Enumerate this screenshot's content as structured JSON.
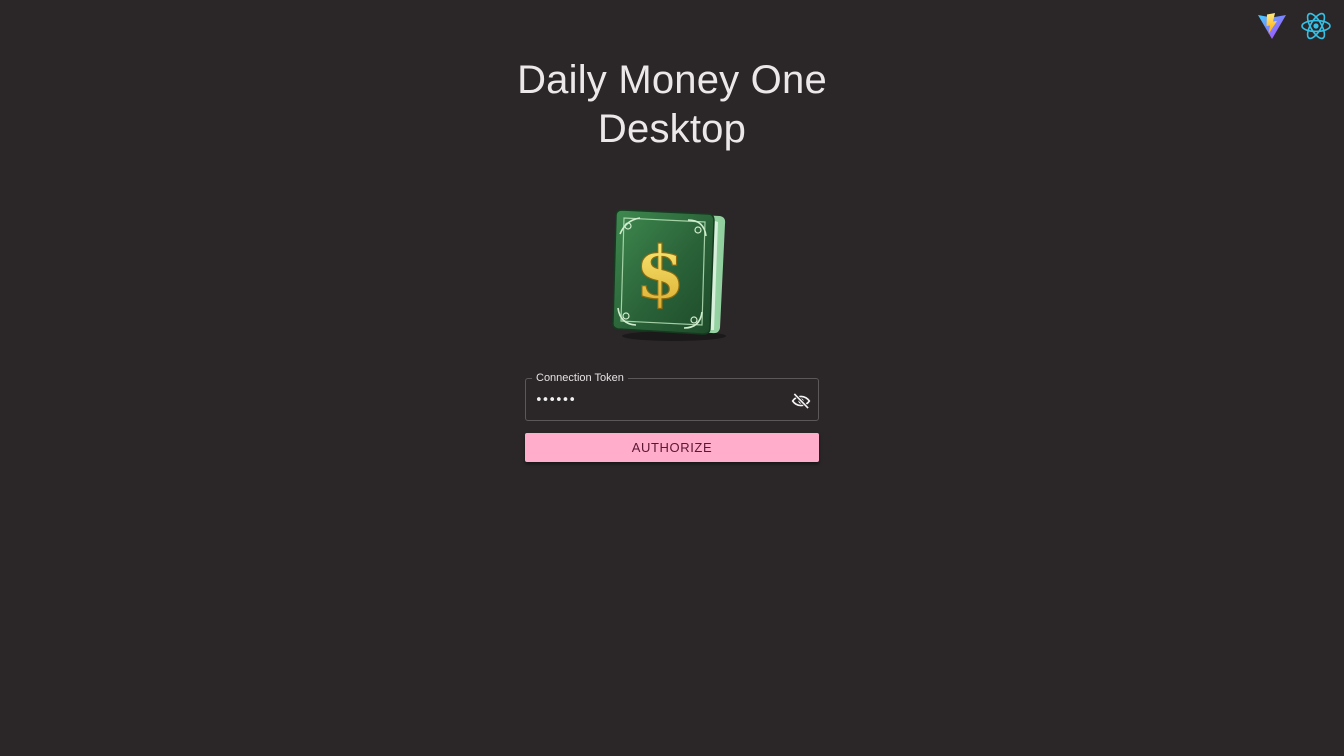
{
  "header": {
    "title_line1": "Daily Money One",
    "title_line2": "Desktop"
  },
  "top_icons": [
    "vite-logo-icon",
    "react-logo-icon"
  ],
  "logo": {
    "icon": "money-book-icon",
    "symbol": "$"
  },
  "form": {
    "token_label": "Connection Token",
    "token_value": "••••••",
    "visibility_icon": "eye-off-icon",
    "authorize_label": "AUTHORIZE"
  },
  "colors": {
    "background": "#2b2729",
    "button": "#ffadcb",
    "button_text": "#5a1733",
    "book_green": "#2f6b3f",
    "book_gold": "#e8c64a"
  }
}
